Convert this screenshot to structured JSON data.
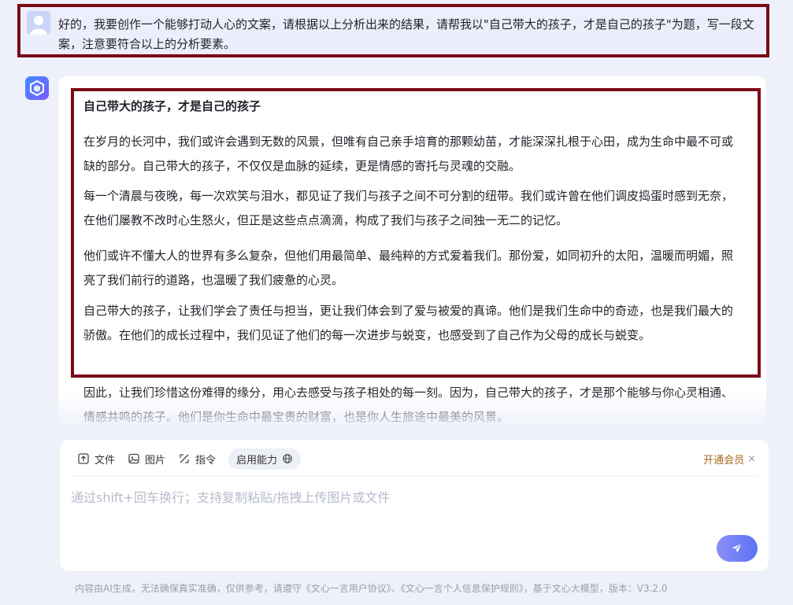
{
  "user_message": {
    "text": "好的，我要创作一个能够打动人心的文案，请根据以上分析出来的结果，请帮我以\"自己带大的孩子，才是自己的孩子\"为题，写一段文案，注意要符合以上的分析要素。"
  },
  "answer": {
    "title": "自己带大的孩子，才是自己的孩子",
    "paragraphs": [
      "在岁月的长河中，我们或许会遇到无数的风景，但唯有自己亲手培育的那颗幼苗，才能深深扎根于心田，成为生命中最不可或缺的部分。自己带大的孩子，不仅仅是血脉的延续，更是情感的寄托与灵魂的交融。",
      "每一个清晨与夜晚，每一次欢笑与泪水，都见证了我们与孩子之间不可分割的纽带。我们或许曾在他们调皮捣蛋时感到无奈，在他们屡教不改时心生怒火，但正是这些点点滴滴，构成了我们与孩子之间独一无二的记忆。",
      "他们或许不懂大人的世界有多么复杂，但他们用最简单、最纯粹的方式爱着我们。那份爱，如同初升的太阳，温暖而明媚，照亮了我们前行的道路，也温暖了我们疲惫的心灵。",
      "自己带大的孩子，让我们学会了责任与担当，更让我们体会到了爱与被爱的真谛。他们是我们生命中的奇迹，也是我们最大的骄傲。在他们的成长过程中，我们见证了他们的每一次进步与蜕变，也感受到了自己作为父母的成长与蜕变。",
      "因此，让我们珍惜这份难得的缘分，用心去感受与孩子相处的每一刻。因为，自己带大的孩子，才是那个能够与你心灵相通、情感共鸣的孩子。他们是你生命中最宝贵的财富，也是你人生旅途中最美的风景。"
    ]
  },
  "toolbar": {
    "file_label": "文件",
    "image_label": "图片",
    "command_label": "指令",
    "ability_label": "启用能力",
    "vip_label": "开通会员",
    "vip_close": "×"
  },
  "input": {
    "placeholder": "通过shift+回车换行；支持复制粘贴/拖拽上传图片或文件"
  },
  "footer": {
    "text": "内容由AI生成，无法确保真实准确，仅供参考，请遵守《文心一言用户协议》、《文心一言个人信息保护规则》，基于文心大模型，版本：V3.2.0"
  },
  "colors": {
    "highlight_border": "#7a0a18",
    "accent": "#5a74f3",
    "vip": "#a8671c"
  }
}
